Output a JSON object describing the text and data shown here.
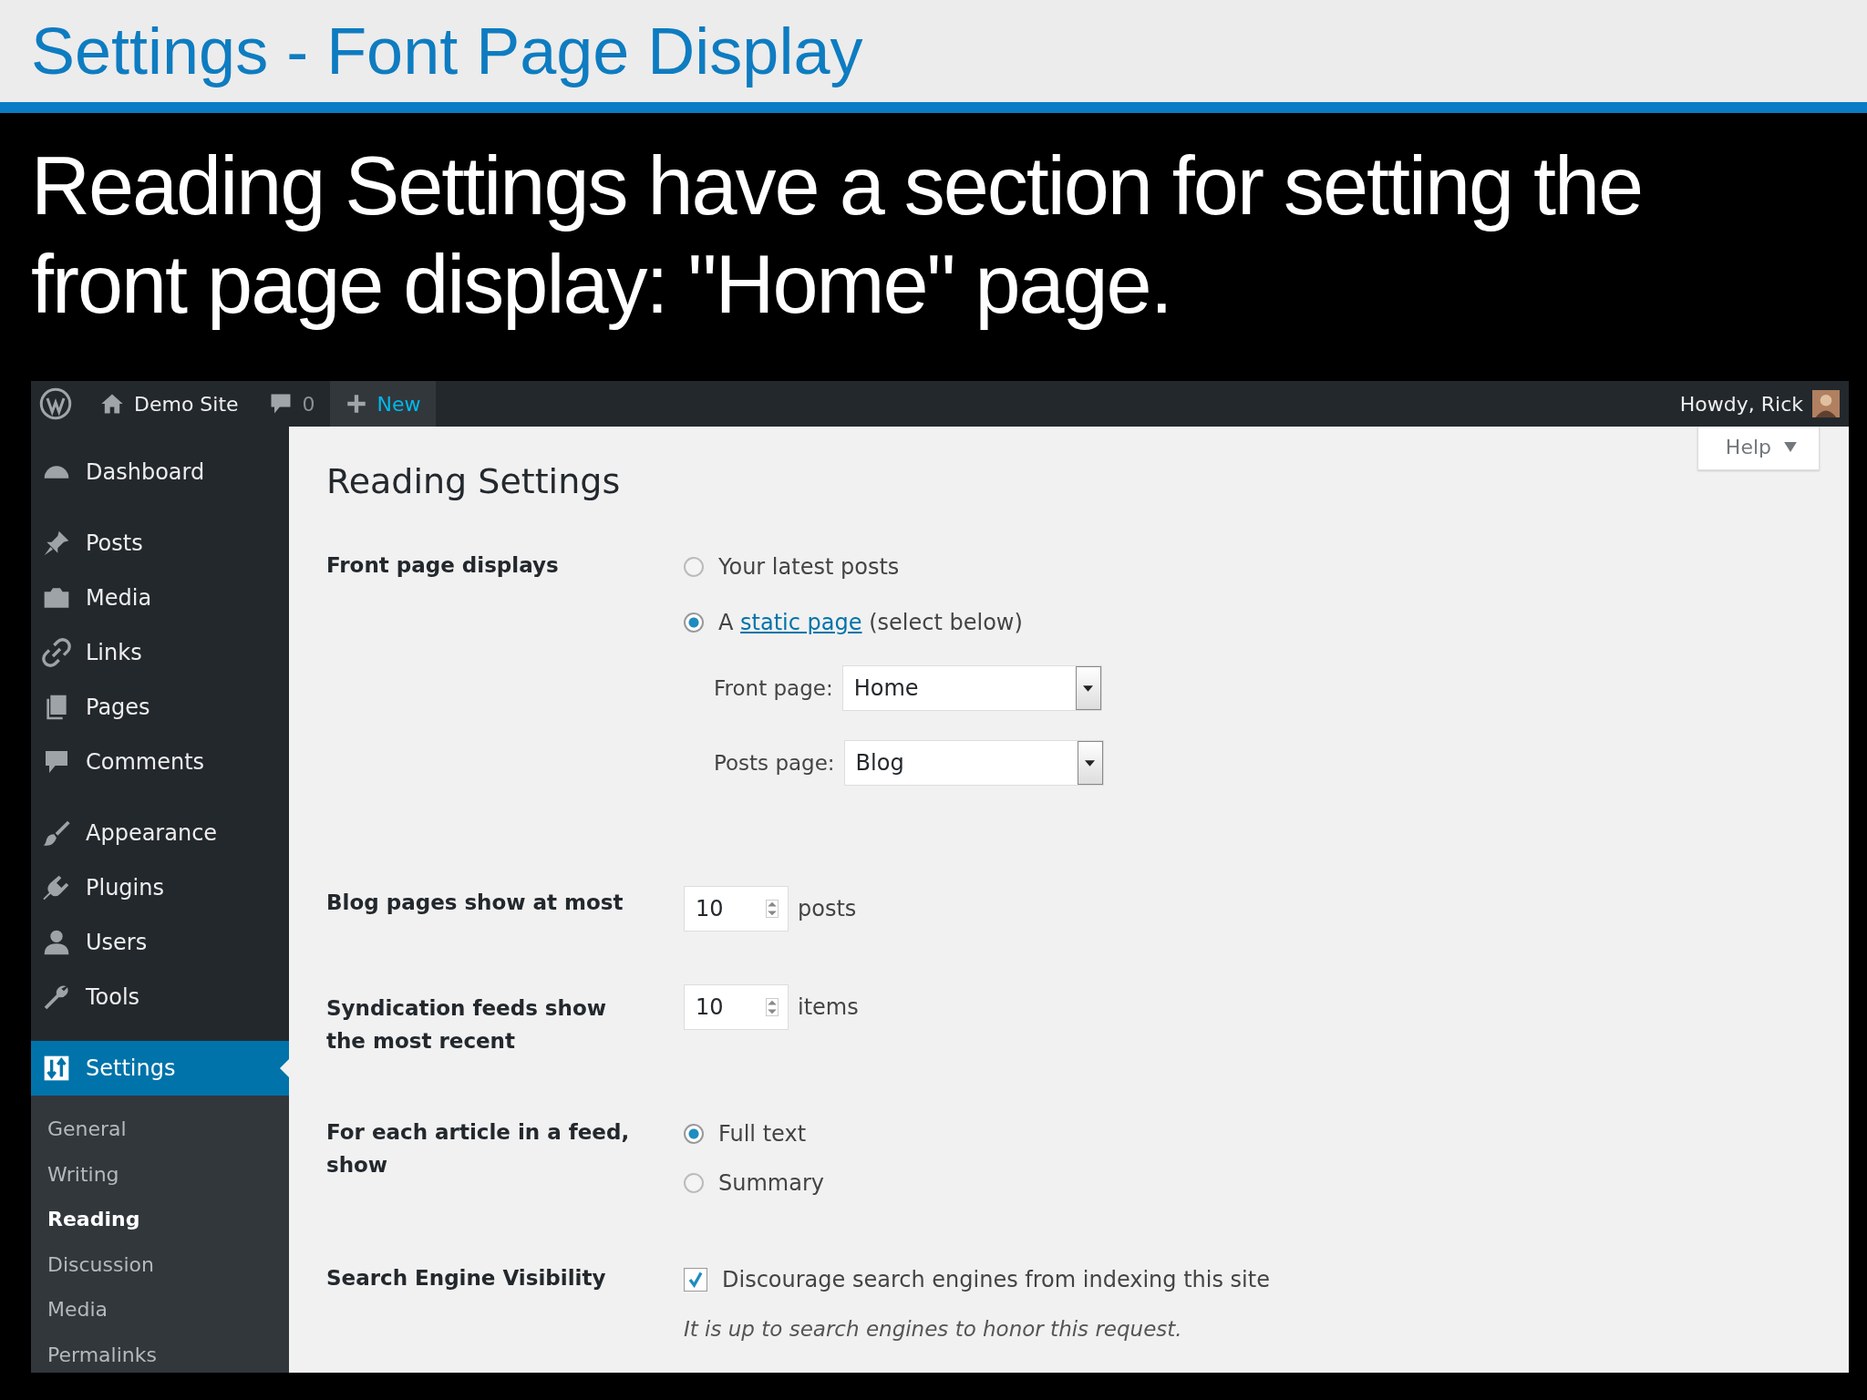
{
  "slide": {
    "title": "Settings - Font Page Display",
    "heading": "Reading Settings have a section for setting the front page display: \"Home\" page."
  },
  "admin_bar": {
    "site_name": "Demo Site",
    "comments_count": "0",
    "new_label": "New",
    "greeting": "Howdy, Rick"
  },
  "help_button": "Help",
  "sidebar": {
    "items": [
      {
        "label": "Dashboard",
        "selected": false
      },
      {
        "label": "Posts",
        "selected": false
      },
      {
        "label": "Media",
        "selected": false
      },
      {
        "label": "Links",
        "selected": false
      },
      {
        "label": "Pages",
        "selected": false
      },
      {
        "label": "Comments",
        "selected": false
      },
      {
        "label": "Appearance",
        "selected": false
      },
      {
        "label": "Plugins",
        "selected": false
      },
      {
        "label": "Users",
        "selected": false
      },
      {
        "label": "Tools",
        "selected": false
      },
      {
        "label": "Settings",
        "selected": true
      }
    ],
    "submenu": [
      {
        "label": "General",
        "selected": false
      },
      {
        "label": "Writing",
        "selected": false
      },
      {
        "label": "Reading",
        "selected": true
      },
      {
        "label": "Discussion",
        "selected": false
      },
      {
        "label": "Media",
        "selected": false
      },
      {
        "label": "Permalinks",
        "selected": false
      }
    ]
  },
  "page_title": "Reading Settings",
  "front_page": {
    "label": "Front page displays",
    "options": [
      {
        "prefix": "Your latest posts",
        "selected": false
      },
      {
        "prefix": "A",
        "link": "static page",
        "suffix": "(select below)",
        "selected": true
      }
    ],
    "selects": [
      {
        "label": "Front page:",
        "value": "Home"
      },
      {
        "label": "Posts page:",
        "value": "Blog"
      }
    ]
  },
  "blog_pages": {
    "label": "Blog pages show at most",
    "value": "10",
    "unit": "posts"
  },
  "syndication": {
    "label": "Syndication feeds show the most recent",
    "value": "10",
    "unit": "items"
  },
  "feed_article": {
    "label": "For each article in a feed, show",
    "options": [
      {
        "prefix": "Full text",
        "selected": true
      },
      {
        "prefix": "Summary",
        "selected": false
      }
    ]
  },
  "search_visibility": {
    "label": "Search Engine Visibility",
    "checkbox": {
      "label": "Discourage search engines from indexing this site",
      "checked": true
    },
    "note": "It is up to search engines to honor this request."
  }
}
